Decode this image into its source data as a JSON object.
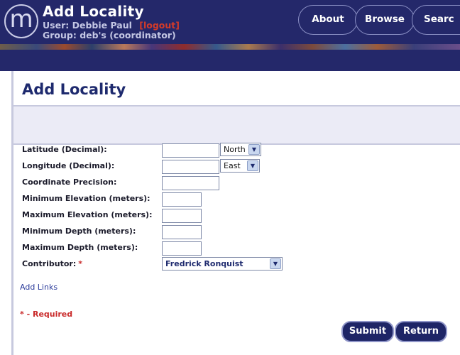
{
  "header": {
    "logo_letter": "m",
    "app_title": "Add Locality",
    "user_prefix": "User:",
    "user_name": "Debbie Paul",
    "logout_label": "[logout]",
    "group_prefix": "Group:",
    "group_name": "deb's (coordinator)"
  },
  "nav": {
    "about": "About",
    "browse": "Browse",
    "search": "Searc"
  },
  "page": {
    "title": "Add Locality"
  },
  "form": {
    "latitude_label": "Latitude (Decimal):",
    "latitude_value": "",
    "latitude_dir": "North",
    "longitude_label": "Longitude (Decimal):",
    "longitude_value": "",
    "longitude_dir": "East",
    "precision_label": "Coordinate Precision:",
    "precision_value": "",
    "min_elev_label": "Minimum Elevation (meters):",
    "min_elev_value": "",
    "max_elev_label": "Maximum Elevation (meters):",
    "max_elev_value": "",
    "min_depth_label": "Minimum Depth (meters):",
    "min_depth_value": "",
    "max_depth_label": "Maximum Depth (meters):",
    "max_depth_value": "",
    "contributor_label": "Contributor:",
    "required_marker": "*",
    "contributor_value": "Fredrick Ronquist"
  },
  "links": {
    "add_links": "Add Links"
  },
  "notes": {
    "required": "* - Required"
  },
  "buttons": {
    "submit": "Submit",
    "return": "Return"
  },
  "colors": {
    "header_bg": "#24286a",
    "title_blue": "#1e2a6e",
    "required_red": "#c92a2a"
  }
}
